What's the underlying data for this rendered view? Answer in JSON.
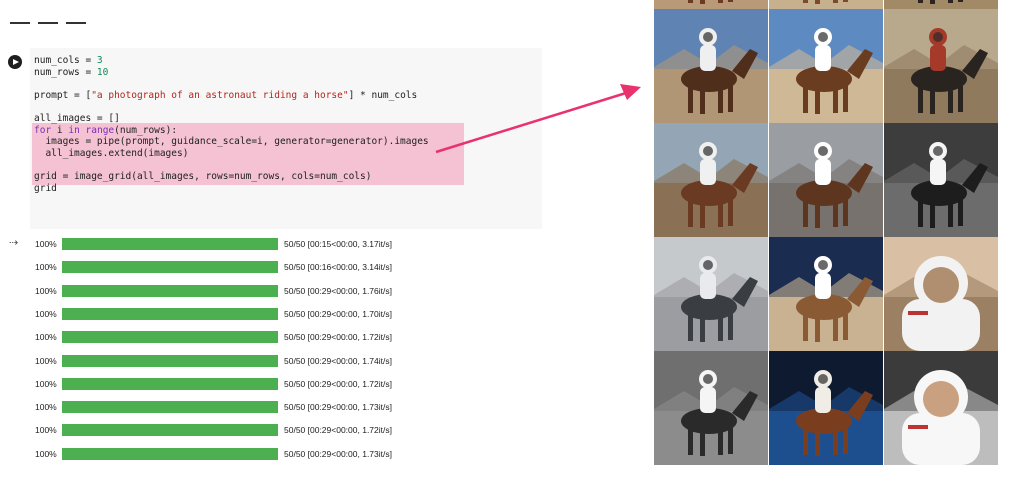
{
  "code_cell": {
    "lines": [
      [
        {
          "t": "num_cols = "
        },
        {
          "t": "3",
          "c": "num"
        }
      ],
      [
        {
          "t": "num_rows = "
        },
        {
          "t": "10",
          "c": "num"
        }
      ],
      null,
      [
        {
          "t": "prompt = ["
        },
        {
          "t": "\"a photograph of an astronaut riding a horse\"",
          "c": "str"
        },
        {
          "t": "] * num_cols"
        }
      ],
      null,
      [
        {
          "t": "all_images = []"
        }
      ],
      [
        {
          "t": "for",
          "c": "kw"
        },
        {
          "t": " i "
        },
        {
          "t": "in",
          "c": "kw"
        },
        {
          "t": " "
        },
        {
          "t": "range",
          "c": "kw"
        },
        {
          "t": "(num_rows):"
        }
      ],
      [
        {
          "t": "  images = pipe(prompt, guidance_scale=i, generator=generator).images"
        }
      ],
      [
        {
          "t": "  all_images.extend(images)"
        }
      ],
      null,
      [
        {
          "t": "grid = image_grid(all_images, rows=num_rows, cols=num_cols)"
        }
      ],
      [
        {
          "t": "grid"
        }
      ]
    ]
  },
  "colors": {
    "highlight": "#f4c2d3",
    "progress_fill": "#4caf50",
    "arrow": "#e8336e"
  },
  "progress_rows": [
    {
      "pct": "100%",
      "fraction": 1.0,
      "stats": "50/50 [00:15<00:00, 3.17it/s]"
    },
    {
      "pct": "100%",
      "fraction": 1.0,
      "stats": "50/50 [00:16<00:00, 3.14it/s]"
    },
    {
      "pct": "100%",
      "fraction": 1.0,
      "stats": "50/50 [00:29<00:00, 1.76it/s]"
    },
    {
      "pct": "100%",
      "fraction": 1.0,
      "stats": "50/50 [00:29<00:00, 1.70it/s]"
    },
    {
      "pct": "100%",
      "fraction": 1.0,
      "stats": "50/50 [00:29<00:00, 1.72it/s]"
    },
    {
      "pct": "100%",
      "fraction": 1.0,
      "stats": "50/50 [00:29<00:00, 1.74it/s]"
    },
    {
      "pct": "100%",
      "fraction": 1.0,
      "stats": "50/50 [00:29<00:00, 1.72it/s]"
    },
    {
      "pct": "100%",
      "fraction": 1.0,
      "stats": "50/50 [00:29<00:00, 1.73it/s]"
    },
    {
      "pct": "100%",
      "fraction": 1.0,
      "stats": "50/50 [00:29<00:00, 1.72it/s]"
    },
    {
      "pct": "100%",
      "fraction": 1.0,
      "stats": "50/50 [00:29<00:00, 1.73it/s]"
    }
  ],
  "image_grid": {
    "columns": 3,
    "tiles": [
      {
        "kind": "horse",
        "sky": "#6a8ab0",
        "ground": "#b99a78",
        "animal": "#6b3a22",
        "rider": "#d8d2c8"
      },
      {
        "kind": "horse",
        "sky": "#9fc2de",
        "ground": "#c7b08e",
        "animal": "#7a4a2a",
        "rider": "#e6e2dc"
      },
      {
        "kind": "horse",
        "sky": "#c9b79b",
        "ground": "#a38a66",
        "animal": "#2c2420",
        "rider": "#c8402e"
      },
      {
        "kind": "horse",
        "sky": "#5f84b3",
        "ground": "#b19676",
        "animal": "#4f2e1c",
        "rider": "#efefef"
      },
      {
        "kind": "horse",
        "sky": "#5d8ac0",
        "ground": "#cfb896",
        "animal": "#6a3c20",
        "rider": "#ffffff"
      },
      {
        "kind": "horse",
        "sky": "#b8a88c",
        "ground": "#8f7a5e",
        "animal": "#2a2420",
        "rider": "#a53a2a"
      },
      {
        "kind": "horse",
        "sky": "#94a6b5",
        "ground": "#8a7054",
        "animal": "#6b3a22",
        "rider": "#f0f0f0"
      },
      {
        "kind": "horse",
        "sky": "#9a9ea3",
        "ground": "#77726d",
        "animal": "#5e3620",
        "rider": "#ffffff"
      },
      {
        "kind": "horse",
        "sky": "#3d3d3d",
        "ground": "#6c6c6c",
        "animal": "#1d1d1d",
        "rider": "#f5f5f5"
      },
      {
        "kind": "horse",
        "sky": "#c6c9cc",
        "ground": "#9c9da0",
        "animal": "#3a3d42",
        "rider": "#e8eaee"
      },
      {
        "kind": "horse",
        "sky": "#1a2c4f",
        "ground": "#c8b292",
        "animal": "#8a5a35",
        "rider": "#ffffff"
      },
      {
        "kind": "portrait",
        "sky": "#d9bfa3",
        "ground": "#9b8063",
        "animal": "#b08f70",
        "rider": "#f2f2f2"
      },
      {
        "kind": "horse",
        "sky": "#6f6f6f",
        "ground": "#8c8c8c",
        "animal": "#2a2a2a",
        "rider": "#f5f5f5"
      },
      {
        "kind": "horse",
        "sky": "#0e1a30",
        "ground": "#1d4f8f",
        "animal": "#7a3e1f",
        "rider": "#f0ede6"
      },
      {
        "kind": "portrait",
        "sky": "#3b3b3b",
        "ground": "#bdbdbd",
        "animal": "#c9a080",
        "rider": "#f7f7f7"
      }
    ]
  }
}
